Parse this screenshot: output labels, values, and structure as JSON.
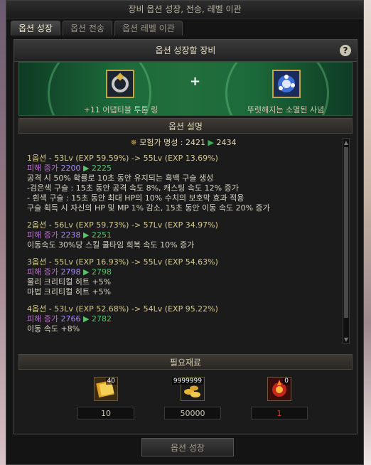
{
  "window": {
    "title": "장비 옵션 성장, 전송, 레벨 이관"
  },
  "tabs": [
    {
      "label": "옵션 성장",
      "active": true
    },
    {
      "label": "옵션 전송",
      "active": false
    },
    {
      "label": "옵션 레벨 이관",
      "active": false
    }
  ],
  "panel": {
    "header": "옵션 성장할 장비",
    "help_label": "?"
  },
  "items": {
    "target": {
      "name": "+11 어댑티블 투톤 링",
      "icon": "ring-icon",
      "color": "#e8e0c8"
    },
    "material": {
      "name": "뚜렷해지는 소멸된 사념",
      "icon": "crystal-flower-icon",
      "color": "#e8e0c8"
    },
    "plus": "+"
  },
  "description": {
    "header": "옵션 설명",
    "fame": {
      "label": "모험가 명성 : 2421",
      "arrow": "▶",
      "to": "2434"
    },
    "options": [
      {
        "title": "1옵션 - 53Lv (EXP 59.59%) -> 55Lv (EXP 13.69%)",
        "dmg_label": "피해 증가",
        "dmg_from": "2200",
        "arrow": "▶",
        "dmg_to": "2225",
        "effects": [
          "공격 시 50% 확률로 10초 동안 유지되는 흑백 구슬 생성",
          "-검은색 구슬 : 15초 동안 공격 속도 8%, 캐스팅 속도 12% 증가",
          "- 흰색 구슬 : 15초 동안 최대 HP의 10% 수치의 보호막 효과 적용",
          "구슬 획득 시 자신의 HP 및 MP 1% 감소, 15초 동안 이동 속도 20% 증가"
        ]
      },
      {
        "title": "2옵션 - 56Lv (EXP 59.73%) -> 57Lv (EXP 34.97%)",
        "dmg_label": "피해 증가",
        "dmg_from": "2238",
        "arrow": "▶",
        "dmg_to": "2251",
        "effects": [
          "이동속도 30%당 스킬 쿨타임 회복 속도 10% 증가"
        ]
      },
      {
        "title": "3옵션 - 55Lv (EXP 16.93%) -> 55Lv (EXP 54.63%)",
        "dmg_label": "피해 증가",
        "dmg_from": "2798",
        "arrow": "▶",
        "dmg_to": "2798",
        "effects": [
          "물리 크리티컬 히트 +5%",
          "마법 크리티컬 히트 +5%"
        ]
      },
      {
        "title": "4옵션 - 53Lv (EXP 52.68%) -> 54Lv (EXP 95.22%)",
        "dmg_label": "피해 증가",
        "dmg_from": "2766",
        "arrow": "▶",
        "dmg_to": "2782",
        "effects": [
          "이동 속도 +8%"
        ]
      }
    ]
  },
  "materials": {
    "header": "필요재료",
    "list": [
      {
        "icon": "gold-card-icon",
        "badge": "40",
        "count": "10",
        "color": "#cfc7b0"
      },
      {
        "icon": "gold-coins-icon",
        "badge": "9999999",
        "count": "50000",
        "color": "#cfc7b0"
      },
      {
        "icon": "flame-orb-icon",
        "badge": "0",
        "count": "1",
        "color": "#e03a2a"
      }
    ]
  },
  "button": {
    "grow_label": "옵션 성장"
  }
}
